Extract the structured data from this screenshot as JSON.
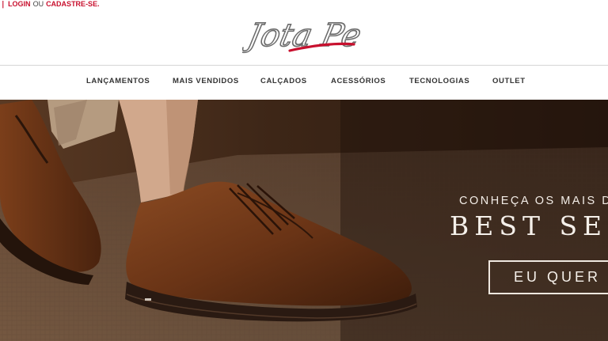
{
  "account": {
    "login_label": "LOGIN",
    "separator": "OU",
    "register_label": "CADASTRE-SE."
  },
  "brand": {
    "logo_text": "Jota Pe",
    "accent_color": "#c8102e"
  },
  "nav": {
    "items": [
      {
        "label": "LANÇAMENTOS"
      },
      {
        "label": "MAIS VENDIDOS"
      },
      {
        "label": "CALÇADOS"
      },
      {
        "label": "ACESSÓRIOS"
      },
      {
        "label": "TECNOLOGIAS"
      },
      {
        "label": "OUTLET"
      }
    ]
  },
  "hero": {
    "subtitle": "CONHEÇA OS MAIS D",
    "title": "BEST SEL",
    "button_label": "EU QUER"
  }
}
